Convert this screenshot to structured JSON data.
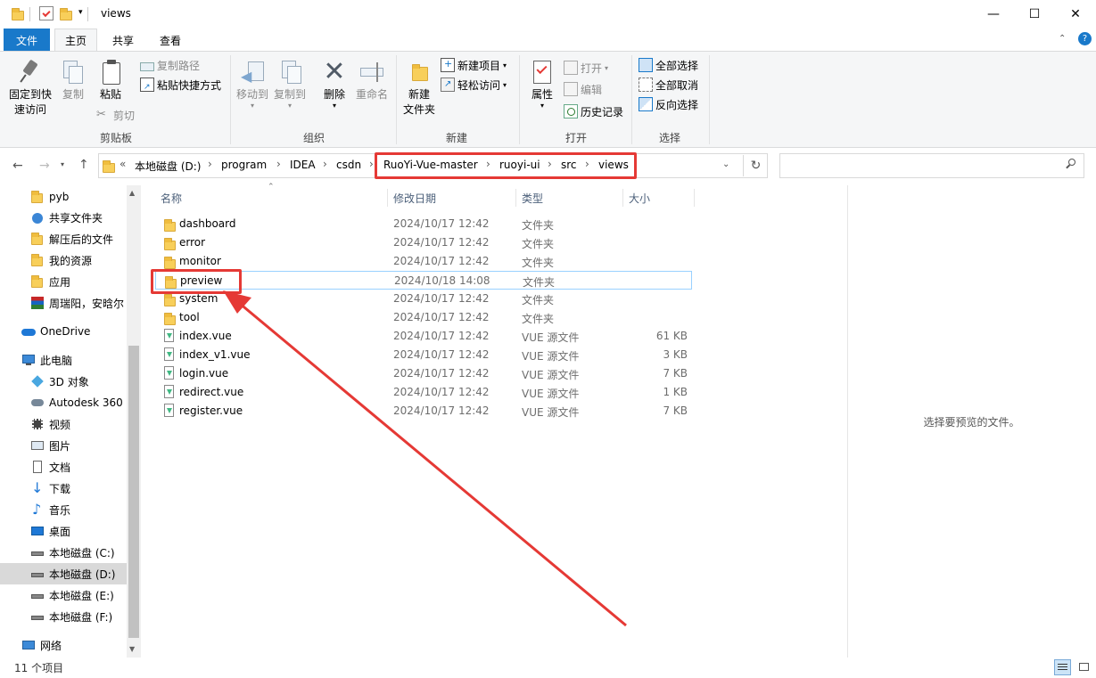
{
  "window": {
    "title": "views",
    "minimize": "—",
    "maximize": "☐",
    "close": "✕"
  },
  "tabs": [
    {
      "label": "文件"
    },
    {
      "label": "主页"
    },
    {
      "label": "共享"
    },
    {
      "label": "查看"
    }
  ],
  "ribbon": {
    "clipboard": {
      "group": "剪贴板",
      "pin_line1": "固定到快",
      "pin_line2": "速访问",
      "copy": "复制",
      "paste": "粘贴",
      "copy_path": "复制路径",
      "paste_shortcut": "粘贴快捷方式",
      "cut": "剪切"
    },
    "organize": {
      "group": "组织",
      "move_to": "移动到",
      "copy_to": "复制到",
      "delete": "删除",
      "rename": "重命名"
    },
    "new": {
      "group": "新建",
      "new_folder_line1": "新建",
      "new_folder_line2": "文件夹",
      "new_item": "新建项目",
      "easy_access": "轻松访问"
    },
    "open": {
      "group": "打开",
      "properties": "属性",
      "open": "打开",
      "edit": "编辑",
      "history": "历史记录"
    },
    "select": {
      "group": "选择",
      "select_all": "全部选择",
      "select_none": "全部取消",
      "invert": "反向选择"
    }
  },
  "address": {
    "overflow": "«",
    "crumbs": [
      "本地磁盘 (D:)",
      "program",
      "IDEA",
      "csdn",
      "RuoYi-Vue-master",
      "ruoyi-ui",
      "src",
      "views"
    ],
    "separator": "›"
  },
  "nav": {
    "items": [
      {
        "label": "pyb",
        "icon": "folder-icon"
      },
      {
        "label": "共享文件夹",
        "icon": "share-icon"
      },
      {
        "label": "解压后的文件",
        "icon": "folder-icon"
      },
      {
        "label": "我的资源",
        "icon": "folder-icon"
      },
      {
        "label": "应用",
        "icon": "folder-icon"
      },
      {
        "label": "周瑞阳，安晗尔",
        "icon": "archive-icon"
      },
      {
        "label": "OneDrive",
        "icon": "cloud-icon"
      },
      {
        "label": "此电脑",
        "icon": "computer-icon"
      },
      {
        "label": "3D 对象",
        "icon": "cube-icon"
      },
      {
        "label": "Autodesk 360",
        "icon": "autodesk-icon"
      },
      {
        "label": "视频",
        "icon": "video-icon"
      },
      {
        "label": "图片",
        "icon": "picture-icon"
      },
      {
        "label": "文档",
        "icon": "document-icon"
      },
      {
        "label": "下载",
        "icon": "download-icon"
      },
      {
        "label": "音乐",
        "icon": "music-icon"
      },
      {
        "label": "桌面",
        "icon": "desktop-icon"
      },
      {
        "label": "本地磁盘 (C:)",
        "icon": "drive-icon"
      },
      {
        "label": "本地磁盘 (D:)",
        "icon": "drive-icon"
      },
      {
        "label": "本地磁盘 (E:)",
        "icon": "drive-icon"
      },
      {
        "label": "本地磁盘 (F:)",
        "icon": "drive-icon"
      },
      {
        "label": "网络",
        "icon": "network-icon"
      }
    ]
  },
  "columns": {
    "name": "名称",
    "date": "修改日期",
    "type": "类型",
    "size": "大小"
  },
  "files": [
    {
      "name": "dashboard",
      "date": "2024/10/17 12:42",
      "type": "文件夹",
      "size": "",
      "kind": "folder"
    },
    {
      "name": "error",
      "date": "2024/10/17 12:42",
      "type": "文件夹",
      "size": "",
      "kind": "folder"
    },
    {
      "name": "monitor",
      "date": "2024/10/17 12:42",
      "type": "文件夹",
      "size": "",
      "kind": "folder"
    },
    {
      "name": "preview",
      "date": "2024/10/18 14:08",
      "type": "文件夹",
      "size": "",
      "kind": "folder"
    },
    {
      "name": "system",
      "date": "2024/10/17 12:42",
      "type": "文件夹",
      "size": "",
      "kind": "folder"
    },
    {
      "name": "tool",
      "date": "2024/10/17 12:42",
      "type": "文件夹",
      "size": "",
      "kind": "folder"
    },
    {
      "name": "index.vue",
      "date": "2024/10/17 12:42",
      "type": "VUE 源文件",
      "size": "61 KB",
      "kind": "vue"
    },
    {
      "name": "index_v1.vue",
      "date": "2024/10/17 12:42",
      "type": "VUE 源文件",
      "size": "3 KB",
      "kind": "vue"
    },
    {
      "name": "login.vue",
      "date": "2024/10/17 12:42",
      "type": "VUE 源文件",
      "size": "7 KB",
      "kind": "vue"
    },
    {
      "name": "redirect.vue",
      "date": "2024/10/17 12:42",
      "type": "VUE 源文件",
      "size": "1 KB",
      "kind": "vue"
    },
    {
      "name": "register.vue",
      "date": "2024/10/17 12:42",
      "type": "VUE 源文件",
      "size": "7 KB",
      "kind": "vue"
    }
  ],
  "preview_pane": {
    "message": "选择要预览的文件。"
  },
  "status": {
    "count": "11 个项目"
  },
  "colors": {
    "accent": "#1979ca",
    "annotation": "#e53935",
    "folder": "#f8cf5a"
  }
}
